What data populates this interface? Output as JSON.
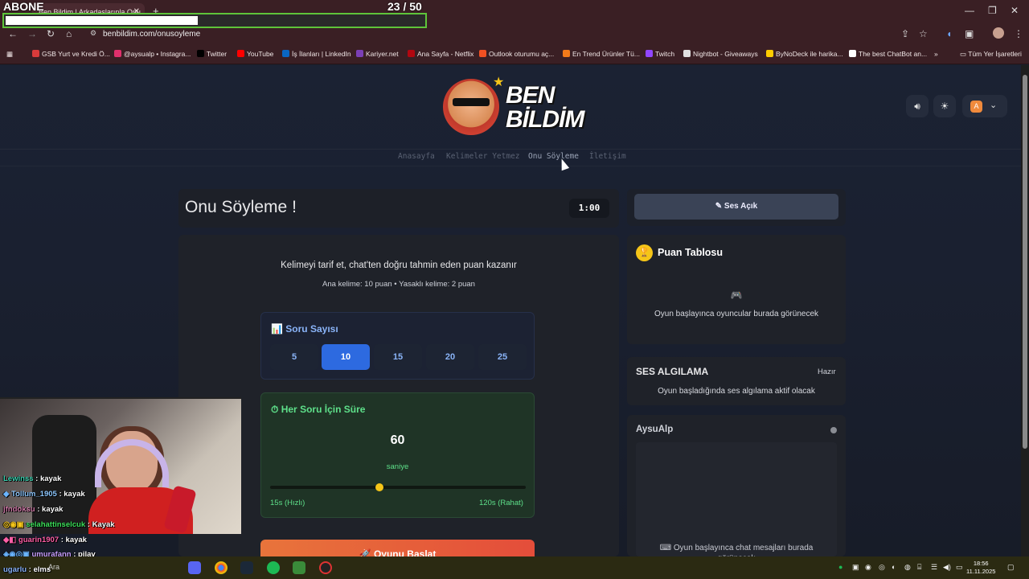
{
  "overlay": {
    "abone_label": "ABONE",
    "sub_count": "23",
    "sub_goal": "/ 50",
    "progress_fraction": 0.46
  },
  "browser": {
    "tab_title": "Ben Bildim | Arkadaşlarınla Onu",
    "tab_close": "✕",
    "new_tab": "+",
    "url": "benbildim.com/onusoyleme",
    "window_controls": [
      "—",
      "❐",
      "✕"
    ],
    "bookmarks": [
      {
        "label": "GSB Yurt ve Kredi Ö...",
        "color": "#d83b3b"
      },
      {
        "label": "@aysualp • Instagra...",
        "color": "#e1306c"
      },
      {
        "label": "Twitter",
        "color": "#000000"
      },
      {
        "label": "YouTube",
        "color": "#ff0000"
      },
      {
        "label": "İş İlanları | LinkedIn",
        "color": "#0a66c2"
      },
      {
        "label": "Kariyer.net",
        "color": "#7b3fb5"
      },
      {
        "label": "Ana Sayfa - Netflix",
        "color": "#b20710"
      },
      {
        "label": "Outlook oturumu aç...",
        "color": "#f25022"
      },
      {
        "label": "En Trend Ürünler Tü...",
        "color": "#f27a1a"
      },
      {
        "label": "Twitch",
        "color": "#9146ff"
      },
      {
        "label": "Nightbot - Giveaways",
        "color": "#e0e0e0"
      },
      {
        "label": "ByNoDeck ile harika...",
        "color": "#ffcc00"
      },
      {
        "label": "The best ChatBot an...",
        "color": "#ffffff"
      }
    ],
    "more_bookmarks": "»",
    "all_bookmarks": "Tüm Yer İşaretleri"
  },
  "site": {
    "logo_line1": "BEN",
    "logo_line2": "BİLDİM",
    "nav": [
      "Anasayfa",
      "Kelimeler Yetmez",
      "Onu Söyleme",
      "İletişim"
    ],
    "user_initial": "A"
  },
  "game": {
    "title": "Onu Söyleme !",
    "timer": "1:00",
    "description": "Kelimeyi tarif et, chat'ten doğru tahmin eden puan kazanır",
    "points_info": "Ana kelime: 10 puan • Yasaklı kelime: 2 puan",
    "question_count": {
      "icon": "📊",
      "title": "Soru Sayısı",
      "options": [
        "5",
        "10",
        "15",
        "20",
        "25"
      ],
      "selected": "10"
    },
    "time_per_question": {
      "icon": "⏱",
      "title": "Her Soru İçin Süre",
      "value": "60",
      "unit": "saniye",
      "min_label": "15s (Hızlı)",
      "max_label": "120s (Rahat)",
      "min": 15,
      "max": 120
    },
    "start_button": "Oyunu Başlat",
    "start_icon": "🚀"
  },
  "sidebar": {
    "sound_button": "Ses Açık",
    "sound_icon": "✎",
    "leaderboard": {
      "icon": "🏆",
      "title": "Puan Tablosu",
      "empty_icon": "🎮",
      "empty_text": "Oyun başlayınca oyuncular burada görünecek"
    },
    "voice_detection": {
      "title": "SES ALGILAMA",
      "status": "Hazır",
      "text": "Oyun başladığında ses algılama aktif olacak"
    },
    "chat": {
      "channel": "AysuAlp",
      "empty_icon": "⌨",
      "empty_text": "Oyun başlayınca chat mesajları burada görünecek"
    }
  },
  "stream_chat": [
    {
      "user": "Lewinss",
      "message": "kayak",
      "color": "#3ad1b0"
    },
    {
      "user": "Tollum_1905",
      "message": "kayak",
      "color": "#8ec8ff"
    },
    {
      "user": "jfndoksu",
      "message": "kayak",
      "color": "#d07aa8"
    },
    {
      "user": "selahattinselcuk",
      "message": "Kayak",
      "color": "#3ce05a"
    },
    {
      "user": "guarin1907",
      "message": "kayak",
      "color": "#ff5fa8"
    },
    {
      "user": "umurafann",
      "message": "pilav",
      "color": "#c8a0ff"
    },
    {
      "user": "ugarlu",
      "message": "elms",
      "color": "#8ab4f8"
    }
  ],
  "taskbar": {
    "search": "Ara",
    "time": "18:56",
    "date": "11.11.2025"
  }
}
